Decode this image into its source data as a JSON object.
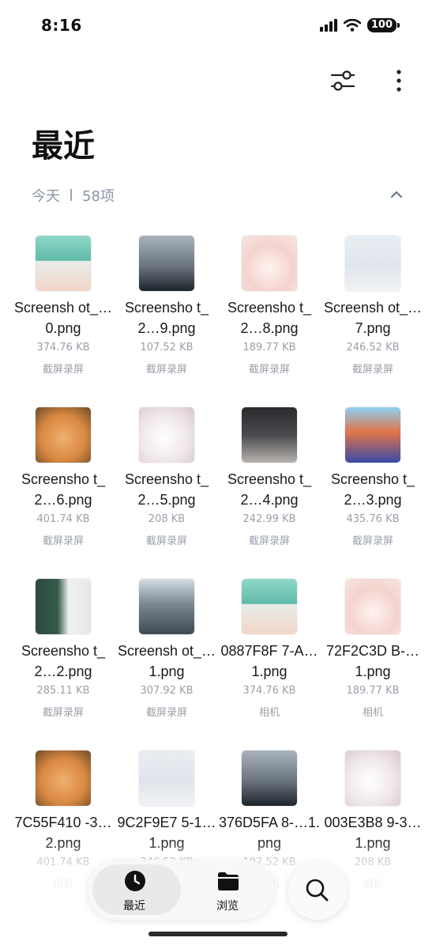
{
  "status_bar": {
    "time": "8:16",
    "battery": "100"
  },
  "header": {
    "title": "最近"
  },
  "section": {
    "date": "今天",
    "count": "58项"
  },
  "files": [
    {
      "name": "Screensh ot_…0.png",
      "size": "374.76 KB",
      "source": "截屏录屏",
      "thumb": "th-girl-water"
    },
    {
      "name": "Screensho t_2…9.png",
      "size": "107.52 KB",
      "source": "截屏录屏",
      "thumb": "th-mountain"
    },
    {
      "name": "Screensho t_2…8.png",
      "size": "189.77 KB",
      "source": "截屏录屏",
      "thumb": "th-cat-white"
    },
    {
      "name": "Screensh ot_…7.png",
      "size": "246.52 KB",
      "source": "截屏录屏",
      "thumb": "th-girl-snow"
    },
    {
      "name": "Screensho t_2…6.png",
      "size": "401.74 KB",
      "source": "截屏录屏",
      "thumb": "th-cat-orange"
    },
    {
      "name": "Screensho t_2…5.png",
      "size": "208 KB",
      "source": "截屏录屏",
      "thumb": "th-cat-white2"
    },
    {
      "name": "Screensho t_2…4.png",
      "size": "242.99 KB",
      "source": "截屏录屏",
      "thumb": "th-girl-dark"
    },
    {
      "name": "Screensho t_2…3.png",
      "size": "435.76 KB",
      "source": "截屏录屏",
      "thumb": "th-girl-redhair"
    },
    {
      "name": "Screensho t_2…2.png",
      "size": "285.11 KB",
      "source": "截屏录屏",
      "thumb": "th-boy"
    },
    {
      "name": "Screensh ot_…1.png",
      "size": "307.92 KB",
      "source": "截屏录屏",
      "thumb": "th-mountain2"
    },
    {
      "name": "0887F8F 7-A…1.png",
      "size": "374.76 KB",
      "source": "相机",
      "thumb": "th-girl-water"
    },
    {
      "name": "72F2C3D B-…1.png",
      "size": "189.77 KB",
      "source": "相机",
      "thumb": "th-cat-white"
    },
    {
      "name": "7C55F410 -3…2.png",
      "size": "401.74 KB",
      "source": "相机",
      "thumb": "th-cat-orange"
    },
    {
      "name": "9C2F9E7 5-1…1.png",
      "size": "246.52 KB",
      "source": "相机",
      "thumb": "th-girl-snow"
    },
    {
      "name": "376D5FA 8-…1.png",
      "size": "107.52 KB",
      "source": "相机",
      "thumb": "th-mountain"
    },
    {
      "name": "003E3B8 9-3…1.png",
      "size": "208 KB",
      "source": "相机",
      "thumb": "th-cat-white2"
    }
  ],
  "bottom_nav": {
    "recent_label": "最近",
    "browse_label": "浏览",
    "recent_icon": "clock-icon",
    "browse_icon": "folder-icon",
    "search_icon": "search-icon"
  },
  "colors": {
    "accent": "#111111",
    "muted": "#8a96a6"
  }
}
